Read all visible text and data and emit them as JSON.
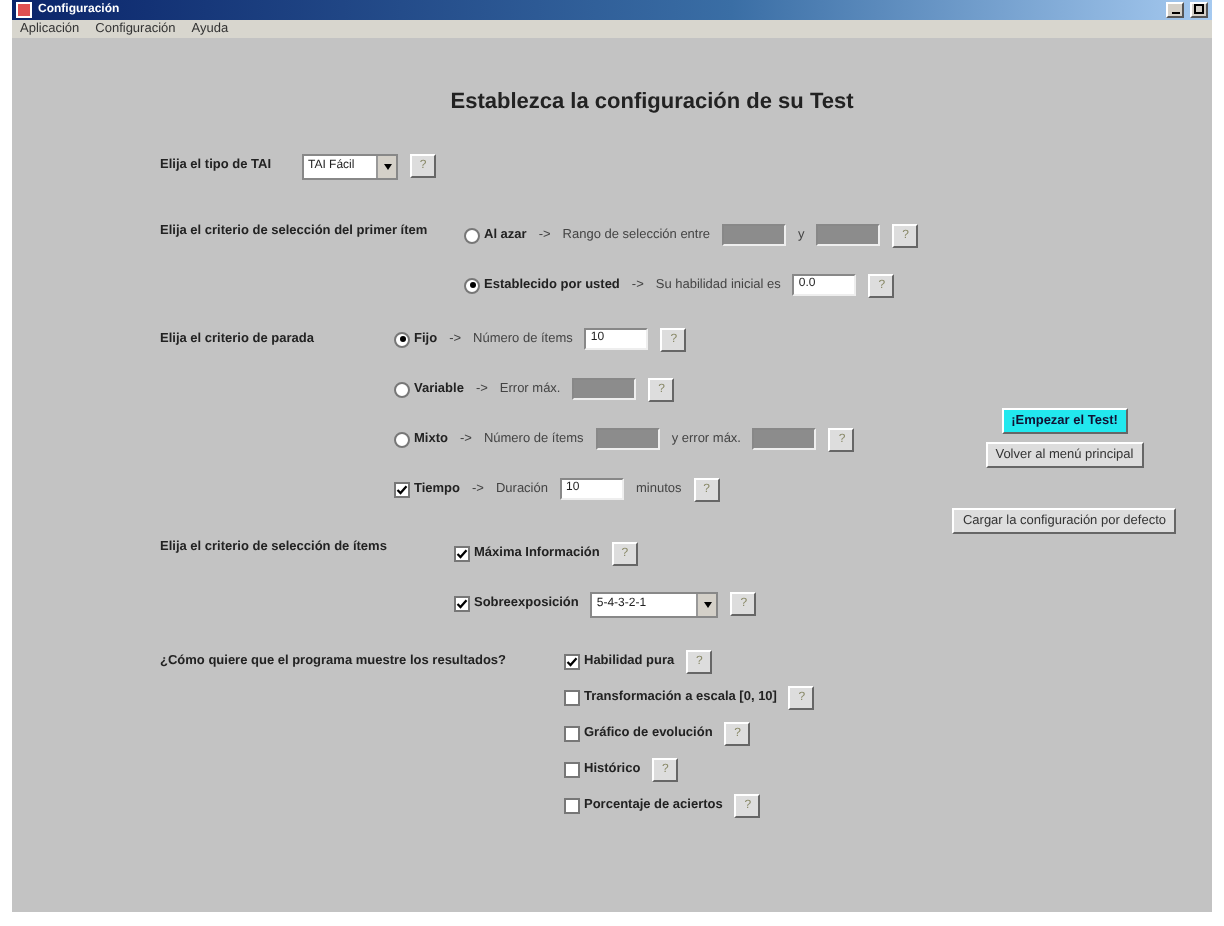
{
  "window": {
    "title": "Configuración"
  },
  "menu": [
    {
      "label": "Aplicación"
    },
    {
      "label": "Configuración"
    },
    {
      "label": "Ayuda"
    }
  ],
  "heading": "Establezca la configuración de su Test",
  "sections": [
    {
      "label": "Elija el tipo de TAI",
      "rows": [
        {
          "parts": [
            {
              "kind": "combo",
              "value": "TAI Fácil"
            },
            {
              "kind": "help",
              "text": "?"
            }
          ]
        }
      ]
    },
    {
      "label": "Elija el criterio de selección del primer ítem",
      "rows": [
        {
          "parts": [
            {
              "kind": "radio",
              "selected": false,
              "label": "Al azar"
            },
            {
              "kind": "arrow",
              "text": "->"
            },
            {
              "kind": "text",
              "text": "Rango de selección entre"
            },
            {
              "kind": "field",
              "disabled": true
            },
            {
              "kind": "text",
              "text": "y"
            },
            {
              "kind": "field",
              "disabled": true
            },
            {
              "kind": "help",
              "text": "?"
            }
          ]
        },
        {
          "parts": [
            {
              "kind": "radio",
              "selected": true,
              "label": "Establecido por usted"
            },
            {
              "kind": "arrow",
              "text": "->"
            },
            {
              "kind": "text",
              "text": "Su habilidad inicial es"
            },
            {
              "kind": "field",
              "disabled": false,
              "value": "0.0"
            },
            {
              "kind": "help",
              "text": "?"
            }
          ]
        }
      ]
    },
    {
      "label": "Elija el criterio de parada",
      "rows": [
        {
          "parts": [
            {
              "kind": "radio",
              "selected": true,
              "label": "Fijo"
            },
            {
              "kind": "arrow",
              "text": "->"
            },
            {
              "kind": "text",
              "text": "Número de ítems"
            },
            {
              "kind": "field",
              "disabled": false,
              "value": "10"
            },
            {
              "kind": "help",
              "text": "?"
            }
          ]
        },
        {
          "parts": [
            {
              "kind": "radio",
              "selected": false,
              "label": "Variable"
            },
            {
              "kind": "arrow",
              "text": "->"
            },
            {
              "kind": "text",
              "text": "Error máx."
            },
            {
              "kind": "field",
              "disabled": true
            },
            {
              "kind": "help",
              "text": "?"
            }
          ]
        },
        {
          "parts": [
            {
              "kind": "radio",
              "selected": false,
              "label": "Mixto"
            },
            {
              "kind": "arrow",
              "text": "->"
            },
            {
              "kind": "text",
              "text": "Número de ítems"
            },
            {
              "kind": "field",
              "disabled": true
            },
            {
              "kind": "text",
              "text": "y error máx."
            },
            {
              "kind": "field",
              "disabled": true
            },
            {
              "kind": "help",
              "text": "?"
            }
          ]
        },
        {
          "parts": [
            {
              "kind": "checkbox",
              "checked": true,
              "label": "Tiempo"
            },
            {
              "kind": "arrow",
              "text": "->"
            },
            {
              "kind": "text",
              "text": "Duración"
            },
            {
              "kind": "field",
              "disabled": false,
              "value": "10"
            },
            {
              "kind": "text",
              "text": "minutos"
            },
            {
              "kind": "help",
              "text": "?"
            }
          ]
        }
      ]
    },
    {
      "label": "Elija el criterio de selección de ítems",
      "rows": [
        {
          "parts": [
            {
              "kind": "checkbox",
              "checked": true,
              "label": "Máxima Información"
            },
            {
              "kind": "help",
              "text": "?"
            }
          ]
        },
        {
          "parts": [
            {
              "kind": "checkbox",
              "checked": true,
              "label": "Sobreexposición"
            },
            {
              "kind": "combo",
              "value": "5-4-3-2-1"
            },
            {
              "kind": "help",
              "text": "?"
            }
          ]
        }
      ]
    },
    {
      "label": "¿Cómo quiere que el programa muestre los resultados?",
      "rows": [
        {
          "parts": [
            {
              "kind": "checkbox",
              "checked": true,
              "label": "Habilidad pura"
            },
            {
              "kind": "help",
              "text": "?"
            }
          ]
        },
        {
          "parts": [
            {
              "kind": "checkbox",
              "checked": false,
              "label": "Transformación a escala [0, 10]"
            },
            {
              "kind": "help",
              "text": "?"
            }
          ]
        },
        {
          "parts": [
            {
              "kind": "checkbox",
              "checked": false,
              "label": "Gráfico de evolución"
            },
            {
              "kind": "help",
              "text": "?"
            }
          ]
        },
        {
          "parts": [
            {
              "kind": "checkbox",
              "checked": false,
              "label": "Histórico"
            },
            {
              "kind": "help",
              "text": "?"
            }
          ]
        },
        {
          "parts": [
            {
              "kind": "checkbox",
              "checked": false,
              "label": "Porcentaje de aciertos"
            },
            {
              "kind": "help",
              "text": "?"
            }
          ]
        }
      ]
    }
  ],
  "buttons": [
    {
      "label": "¡Empezar el Test!",
      "highlighted": true
    },
    {
      "label": "Volver al menú principal",
      "highlighted": false
    },
    {
      "label": "Cargar la configuración por defecto",
      "highlighted": false
    }
  ]
}
